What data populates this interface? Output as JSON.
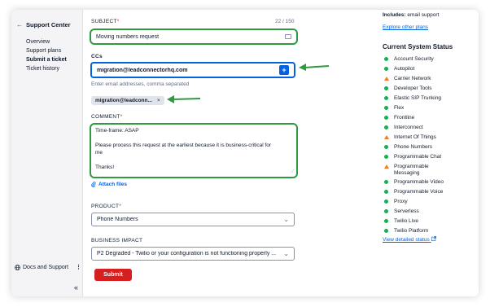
{
  "sidebar": {
    "back_icon": "arrow-left-icon",
    "title": "Support Center",
    "items": [
      {
        "label": "Overview",
        "active": false
      },
      {
        "label": "Support plans",
        "active": false
      },
      {
        "label": "Submit a ticket",
        "active": true
      },
      {
        "label": "Ticket history",
        "active": false
      }
    ],
    "footer_label": "Docs and Support",
    "footer_menu": "⋮",
    "collapse_label": "«"
  },
  "form": {
    "subject_label": "SUBJECT",
    "required_mark": "*",
    "subject_counter": "22 / 150",
    "subject_value": "Moving numbers request",
    "cc_label": "CCs",
    "cc_value": "migration@leadconnectorhq.com",
    "cc_add_label": "+",
    "cc_help": "Enter email addresses, comma separated",
    "cc_pill": "migration@leadconn...",
    "cc_pill_remove": "×",
    "comment_label": "COMMENT",
    "comment_lines": [
      "Time-frame: ASAP",
      "",
      "Please process this request at the earliest because it is business-critical for",
      "me",
      "",
      "Thanks!"
    ],
    "attach_label": "Attach files",
    "product_label": "PRODUCT",
    "product_value": "Phone Numbers",
    "impact_label": "BUSINESS IMPACT",
    "impact_value": "P2 Degraded - Twilio or your configuration is not functioning properly ...",
    "submit_label": "Submit"
  },
  "right_panel": {
    "includes_label": "Includes:",
    "includes_value": "email support",
    "explore_link": "Explore other plans",
    "status_title": "Current System Status",
    "services": [
      {
        "name": "Account Security",
        "status": "operational"
      },
      {
        "name": "Autopilot",
        "status": "operational"
      },
      {
        "name": "Carrier Network",
        "status": "degraded"
      },
      {
        "name": "Developer Tools",
        "status": "operational"
      },
      {
        "name": "Elastic SIP Trunking",
        "status": "operational"
      },
      {
        "name": "Flex",
        "status": "operational"
      },
      {
        "name": "Frontline",
        "status": "operational"
      },
      {
        "name": "Interconnect",
        "status": "operational"
      },
      {
        "name": "Internet Of Things",
        "status": "degraded"
      },
      {
        "name": "Phone Numbers",
        "status": "operational"
      },
      {
        "name": "Programmable Chat",
        "status": "operational"
      },
      {
        "name": "Programmable\nMessaging",
        "status": "degraded"
      },
      {
        "name": "Programmable Video",
        "status": "operational"
      },
      {
        "name": "Programmable Voice",
        "status": "operational"
      },
      {
        "name": "Proxy",
        "status": "operational"
      },
      {
        "name": "Serverless",
        "status": "operational"
      },
      {
        "name": "Twilio Live",
        "status": "operational"
      },
      {
        "name": "Twilio Platform",
        "status": "operational"
      }
    ],
    "detailed_link": "View detailed status",
    "external_icon": "external-link-icon"
  },
  "colors": {
    "highlight": "#2f9a3f",
    "accent": "#0263e0",
    "submit": "#d61f1f",
    "operational": "#14b053",
    "degraded": "#f47c22"
  }
}
